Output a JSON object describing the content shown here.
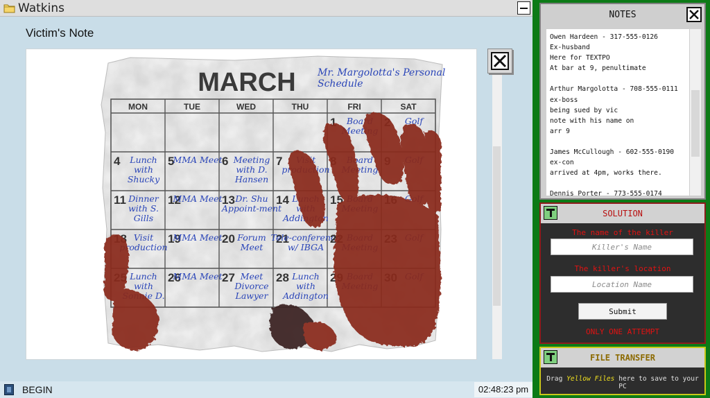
{
  "window": {
    "title": "Watkins",
    "subtitle": "Victim's Note"
  },
  "document": {
    "calendar": {
      "month": "MARCH",
      "header_note": "Mr. Margolotta's Personal Schedule",
      "weekdays": [
        "MON",
        "TUE",
        "WED",
        "THU",
        "FRI",
        "SAT"
      ],
      "cells": [
        {
          "day": "1",
          "text": "Board Meeting"
        },
        {
          "day": "2",
          "text": "Golf"
        },
        {
          "day": "4",
          "text": "Lunch with Shucky"
        },
        {
          "day": "5",
          "text": "MMA Meet"
        },
        {
          "day": "6",
          "text": "Meeting with D. Hansen"
        },
        {
          "day": "7",
          "text": "Visit production"
        },
        {
          "day": "8",
          "text": "Board Meeting"
        },
        {
          "day": "9",
          "text": "Golf"
        },
        {
          "day": "11",
          "text": "Dinner with S. Gills"
        },
        {
          "day": "12",
          "text": "MMA Meet"
        },
        {
          "day": "13",
          "text": "Dr. Shu Appoint-ment"
        },
        {
          "day": "14",
          "text": "Lunch with Addington"
        },
        {
          "day": "15",
          "text": "Board Meeting"
        },
        {
          "day": "16",
          "text": "Golf"
        },
        {
          "day": "18",
          "text": "Visit production"
        },
        {
          "day": "19",
          "text": "MMA Meet"
        },
        {
          "day": "20",
          "text": "Forum Meet"
        },
        {
          "day": "21",
          "text": "Tele-conference w/ IBGA"
        },
        {
          "day": "22",
          "text": "Board Meeting"
        },
        {
          "day": "23",
          "text": "Golf"
        },
        {
          "day": "25",
          "text": "Lunch with Sonnie D."
        },
        {
          "day": "26",
          "text": "MMA Meet"
        },
        {
          "day": "27",
          "text": "Meet Divorce Lawyer"
        },
        {
          "day": "28",
          "text": "Lunch with Addington"
        },
        {
          "day": "29",
          "text": "Board Meeting"
        },
        {
          "day": "30",
          "text": "Golf"
        }
      ]
    }
  },
  "taskbar": {
    "begin_label": "BEGIN",
    "clock": "02:48:23 pm"
  },
  "notes": {
    "title": "NOTES",
    "lines": [
      "Owen Hardeen - 317-555-0126",
      "Ex-husband",
      "Here for TEXTPO",
      "At bar at 9, penultimate",
      "",
      "Arthur Margolotta - 708-555-0111",
      "ex-boss",
      "being sued by vic",
      "note with his name on",
      "arr 9",
      "",
      "James McCullough - 602-555-0190",
      "ex-con",
      "arrived at 4pm, works there.",
      "",
      "Dennis Porter - 773-555-0174"
    ]
  },
  "solution": {
    "title": "SOLUTION",
    "killer_label": "The name of the killer",
    "killer_placeholder": "Killer's Name",
    "location_label": "The killer's location",
    "location_placeholder": "Location Name",
    "submit_label": "Submit",
    "warning": "ONLY ONE ATTEMPT"
  },
  "file_transfer": {
    "title": "FILE TRANSFER",
    "desc_prefix": "Drag ",
    "desc_highlight": "Yellow Files",
    "desc_suffix": " here to save to your PC"
  },
  "colors": {
    "window_bg": "#c9dde8",
    "right_bg": "#0c7a16",
    "ink_blue": "#2a45b8",
    "blood": "#8a2a1e",
    "solution_red": "#e21212",
    "transfer_yellow": "#c9c81a"
  }
}
